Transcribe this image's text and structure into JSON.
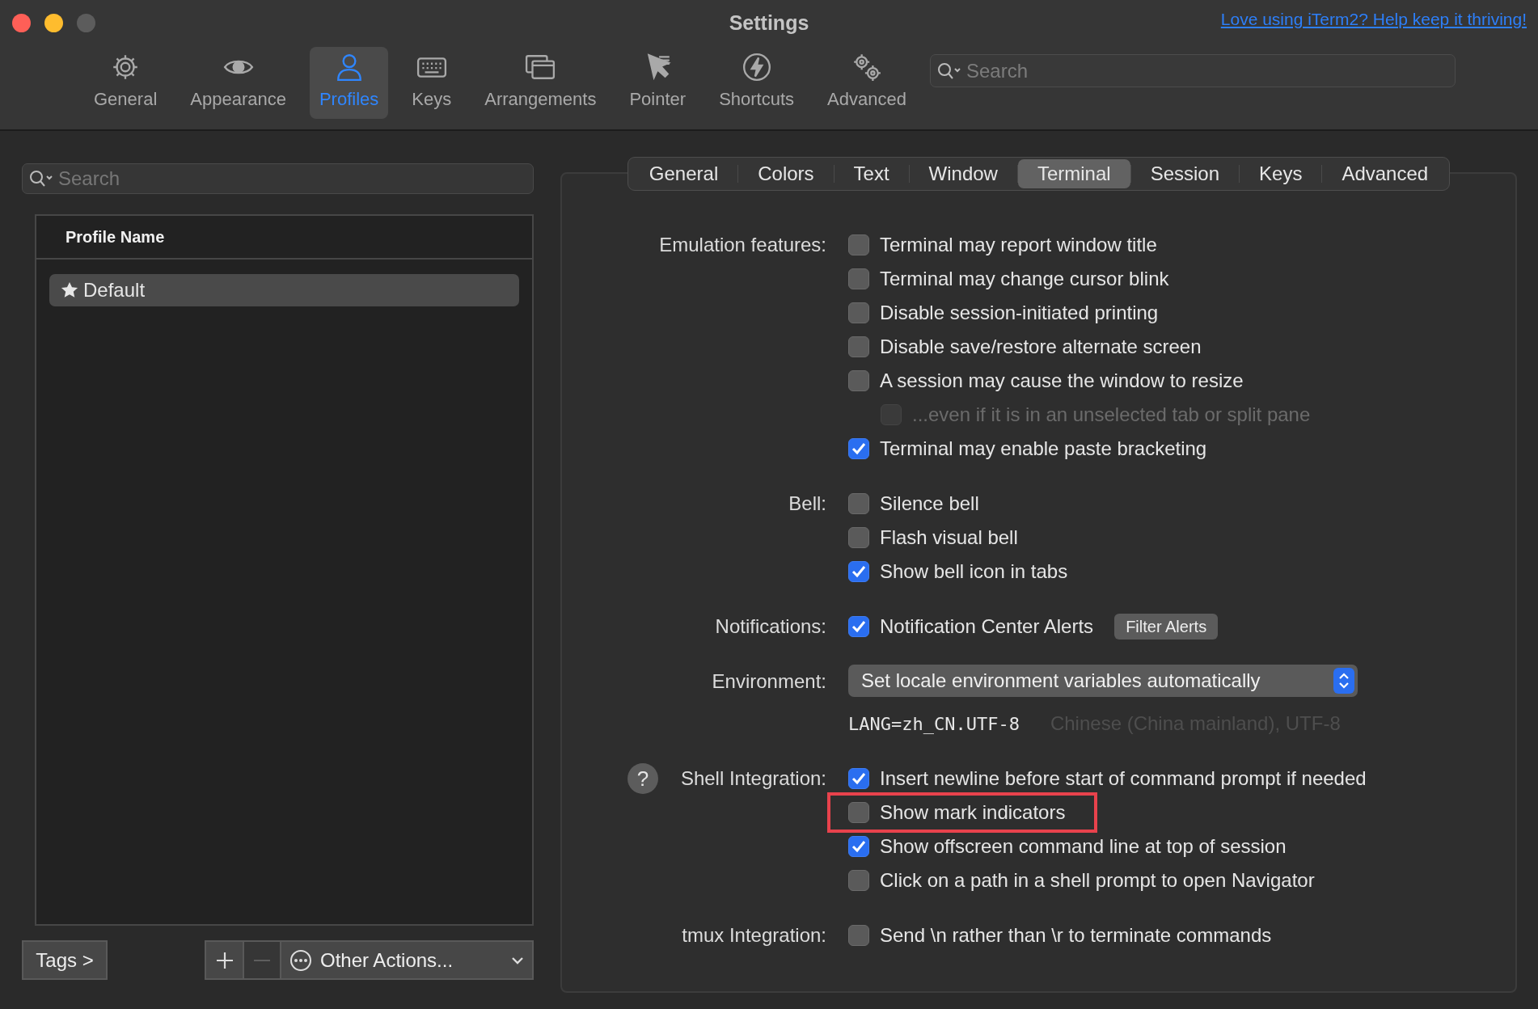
{
  "window": {
    "title": "Settings",
    "promo_link": "Love using iTerm2? Help keep it thriving!"
  },
  "toolbar": {
    "items": [
      {
        "label": "General",
        "selected": false
      },
      {
        "label": "Appearance",
        "selected": false
      },
      {
        "label": "Profiles",
        "selected": true
      },
      {
        "label": "Keys",
        "selected": false
      },
      {
        "label": "Arrangements",
        "selected": false
      },
      {
        "label": "Pointer",
        "selected": false
      },
      {
        "label": "Shortcuts",
        "selected": false
      },
      {
        "label": "Advanced",
        "selected": false
      }
    ],
    "search": {
      "placeholder": "Search"
    }
  },
  "profiles": {
    "search": {
      "placeholder": "Search"
    },
    "column": "Profile Name",
    "rows": [
      {
        "name": "Default",
        "selected": true
      }
    ],
    "tags_button": "Tags >",
    "other_actions": "Other Actions..."
  },
  "tabs": [
    {
      "label": "General",
      "selected": false
    },
    {
      "label": "Colors",
      "selected": false
    },
    {
      "label": "Text",
      "selected": false
    },
    {
      "label": "Window",
      "selected": false
    },
    {
      "label": "Terminal",
      "selected": true
    },
    {
      "label": "Session",
      "selected": false
    },
    {
      "label": "Keys",
      "selected": false
    },
    {
      "label": "Advanced",
      "selected": false
    }
  ],
  "sections": [
    {
      "kind": "checkboxes",
      "label": "Emulation features:",
      "options": [
        {
          "label": "Terminal may report window title",
          "checked": false
        },
        {
          "label": "Terminal may change cursor blink",
          "checked": false
        },
        {
          "label": "Disable session-initiated printing",
          "checked": false
        },
        {
          "label": "Disable save/restore alternate screen",
          "checked": false
        },
        {
          "label": "A session may cause the window to resize",
          "checked": false,
          "children": [
            {
              "label": "...even if it is in an unselected tab or split pane",
              "checked": false,
              "disabled": true
            }
          ]
        },
        {
          "label": "Terminal may enable paste bracketing",
          "checked": true
        }
      ]
    },
    {
      "kind": "checkboxes",
      "label": "Bell:",
      "options": [
        {
          "label": "Silence bell",
          "checked": false
        },
        {
          "label": "Flash visual bell",
          "checked": false
        },
        {
          "label": "Show bell icon in tabs",
          "checked": true
        }
      ]
    },
    {
      "kind": "checkboxes",
      "label": "Notifications:",
      "button": "Filter Alerts",
      "options": [
        {
          "label": "Notification Center Alerts",
          "checked": true
        }
      ]
    },
    {
      "kind": "popup",
      "label": "Environment:",
      "value": "Set locale environment variables automatically",
      "lang": "LANG=zh_CN.UTF-8",
      "lang_description": "Chinese (China mainland), UTF-8"
    },
    {
      "kind": "checkboxes",
      "label": "Shell Integration:",
      "help": "?",
      "options": [
        {
          "label": "Insert newline before start of command prompt if needed",
          "checked": true
        },
        {
          "label": "Show mark indicators",
          "checked": false,
          "highlighted": true
        },
        {
          "label": "Show offscreen command line at top of session",
          "checked": true
        },
        {
          "label": "Click on a path in a shell prompt to open Navigator",
          "checked": false
        }
      ]
    },
    {
      "kind": "checkboxes",
      "label": "tmux Integration:",
      "options": [
        {
          "label": "Send \\n rather than \\r to terminate commands",
          "checked": false
        }
      ]
    }
  ]
}
